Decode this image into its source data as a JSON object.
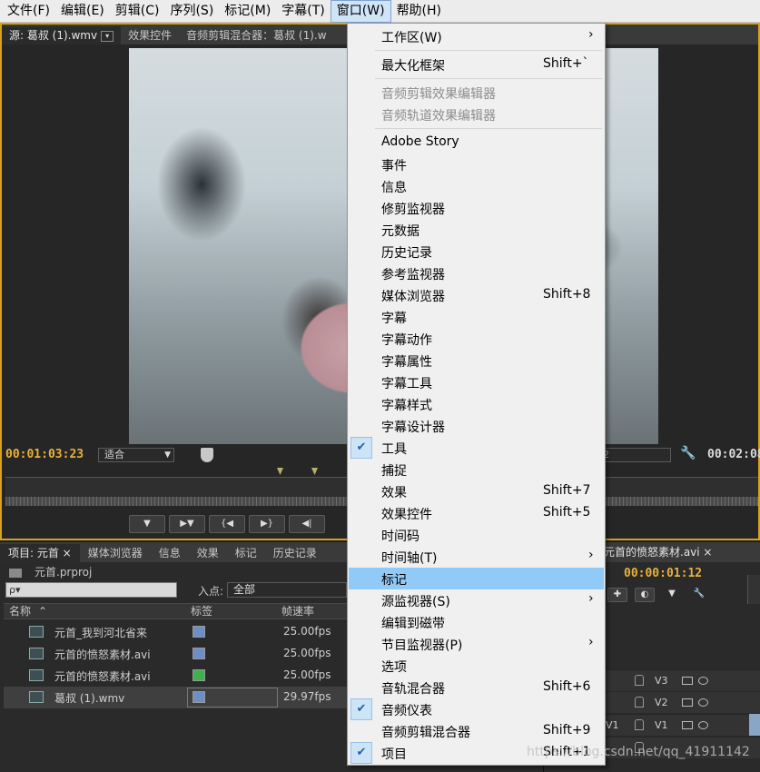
{
  "menubar": {
    "items": [
      {
        "label": "文件(F)"
      },
      {
        "label": "编辑(E)"
      },
      {
        "label": "剪辑(C)"
      },
      {
        "label": "序列(S)"
      },
      {
        "label": "标记(M)"
      },
      {
        "label": "字幕(T)"
      },
      {
        "label": "窗口(W)",
        "open": true
      },
      {
        "label": "帮助(H)"
      }
    ]
  },
  "source_monitor": {
    "tabs": [
      {
        "label": "源: 葛叔 (1).wmv"
      },
      {
        "label": "效果控件"
      },
      {
        "label": "音频剪辑混合器：葛叔 (1).w"
      }
    ],
    "timecode": "00:01:03:23",
    "fit_select": "适合",
    "right_select": "2",
    "duration": "00:02:08"
  },
  "project_panel": {
    "tabs": [
      {
        "label": "项目: 元首 ×"
      },
      {
        "label": "媒体浏览器"
      },
      {
        "label": "信息"
      },
      {
        "label": "效果"
      },
      {
        "label": "标记"
      },
      {
        "label": "历史记录"
      }
    ],
    "project_file": "元首.prproj",
    "search_placeholder": "ρ▾",
    "inpoint_label": "入点:",
    "inpoint_value": "全部",
    "columns": {
      "name": "名称",
      "label": "标签",
      "rate": "帧速率"
    },
    "rows": [
      {
        "name": "元首_我到河北省来",
        "rate": "25.00fps",
        "label_color": "#6e8fc6"
      },
      {
        "name": "元首的愤怒素材.avi",
        "rate": "25.00fps",
        "label_color": "#6e8fc6"
      },
      {
        "name": "元首的愤怒素材.avi",
        "rate": "25.00fps",
        "label_color": "#3fb24f"
      },
      {
        "name": "葛叔 (1).wmv",
        "rate": "29.97fps",
        "label_color": "#6e8fc6",
        "selected": true
      }
    ]
  },
  "timeline_panel": {
    "tab": "元首的愤怒素材.avi ×",
    "timecode": "00:00:01:12",
    "tracks": [
      {
        "name": "V3"
      },
      {
        "name": "V2"
      },
      {
        "name": "V1",
        "side_label": "V1"
      }
    ]
  },
  "window_menu": {
    "items": [
      {
        "label": "工作区(W)",
        "submenu": true
      },
      {
        "label": "最大化框架",
        "shortcut": "Shift+`"
      },
      {
        "label": "音频剪辑效果编辑器",
        "disabled": true
      },
      {
        "label": "音频轨道效果编辑器",
        "disabled": true
      },
      {
        "label": "Adobe Story"
      },
      {
        "label": "事件"
      },
      {
        "label": "信息"
      },
      {
        "label": "修剪监视器"
      },
      {
        "label": "元数据"
      },
      {
        "label": "历史记录"
      },
      {
        "label": "参考监视器"
      },
      {
        "label": "媒体浏览器",
        "shortcut": "Shift+8"
      },
      {
        "label": "字幕"
      },
      {
        "label": "字幕动作"
      },
      {
        "label": "字幕属性"
      },
      {
        "label": "字幕工具"
      },
      {
        "label": "字幕样式"
      },
      {
        "label": "字幕设计器"
      },
      {
        "label": "工具",
        "checked": true
      },
      {
        "label": "捕捉"
      },
      {
        "label": "效果",
        "shortcut": "Shift+7"
      },
      {
        "label": "效果控件",
        "shortcut": "Shift+5"
      },
      {
        "label": "时间码"
      },
      {
        "label": "时间轴(T)",
        "submenu": true
      },
      {
        "label": "标记",
        "highlighted": true
      },
      {
        "label": "源监视器(S)",
        "submenu": true
      },
      {
        "label": "编辑到磁带"
      },
      {
        "label": "节目监视器(P)",
        "submenu": true
      },
      {
        "label": "选项"
      },
      {
        "label": "音轨混合器",
        "shortcut": "Shift+6"
      },
      {
        "label": "音频仪表",
        "checked": true
      },
      {
        "label": "音频剪辑混合器",
        "shortcut": "Shift+9"
      },
      {
        "label": "项目",
        "checked": true,
        "shortcut": "Shift+1"
      }
    ]
  },
  "watermark": "https://blog.csdn.net/qq_41911142"
}
